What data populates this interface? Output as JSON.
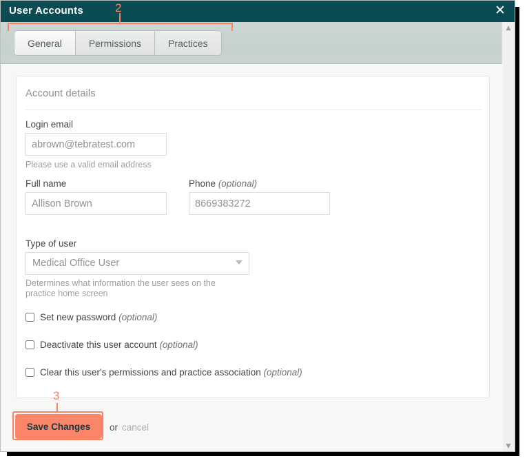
{
  "window": {
    "title": "User Accounts",
    "close_icon": "close-icon",
    "accent_color": "#0b4b53",
    "annotation_color": "#f7845f",
    "button_color": "#fa8569"
  },
  "tabs": [
    {
      "label": "General",
      "active": true
    },
    {
      "label": "Permissions",
      "active": false
    },
    {
      "label": "Practices",
      "active": false
    }
  ],
  "scrollbar": {
    "up_icon": "chevron-up-icon",
    "down_icon": "chevron-down-icon",
    "up_glyph": "▲",
    "down_glyph": "▼"
  },
  "card": {
    "title": "Account details",
    "fields": {
      "login_email": {
        "label": "Login email",
        "value": "abrown@tebratest.com",
        "placeholder": "abrown@tebratest.com",
        "hint": "Please use a valid email address"
      },
      "full_name": {
        "label": "Full name",
        "value": "Allison Brown",
        "placeholder": "Allison Brown"
      },
      "phone": {
        "label": "Phone",
        "optional": "(optional)",
        "value": "8669383272",
        "placeholder": "8669383272"
      },
      "type_of_user": {
        "label": "Type of user",
        "value": "Medical Office User",
        "options": [
          "Medical Office User"
        ],
        "hint": "Determines what information the user sees on the practice home screen",
        "caret_icon": "triangle-down-icon"
      }
    },
    "checkboxes": [
      {
        "label": "Set new password",
        "optional": "(optional)",
        "checked": false
      },
      {
        "label": "Deactivate this user account",
        "optional": "(optional)",
        "checked": false
      },
      {
        "label": "Clear this user's permissions and practice association",
        "optional": "(optional)",
        "checked": false
      }
    ]
  },
  "footer": {
    "save_label": "Save Changes",
    "or_text": "or",
    "cancel_label": "cancel"
  },
  "annotations": {
    "step_2": "2",
    "step_3": "3"
  }
}
